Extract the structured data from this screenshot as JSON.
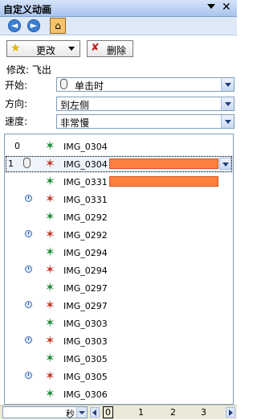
{
  "titlebar": {
    "title": "自定义动画",
    "close": "✕"
  },
  "nav": {
    "back": "◄",
    "forward": "►",
    "home": "⌂"
  },
  "toolbar": {
    "change_label": "更改",
    "remove_label": "删除"
  },
  "modify": {
    "label": "修改: 飞出"
  },
  "start": {
    "label": "开始:",
    "value": "单击时"
  },
  "direction": {
    "label": "方向:",
    "value": "到左侧"
  },
  "speed": {
    "label": "速度:",
    "value": "非常慢"
  },
  "colors": {
    "accent_bar": "#ff7f3f",
    "selection": "#316ac5"
  },
  "list": {
    "rows": [
      {
        "num": "0",
        "name": "IMG_0304"
      },
      {
        "num": "1",
        "name": "IMG_0304"
      },
      {
        "num": "",
        "name": "IMG_0331"
      },
      {
        "num": "",
        "name": "IMG_0331"
      },
      {
        "num": "",
        "name": "IMG_0292"
      },
      {
        "num": "",
        "name": "IMG_0292"
      },
      {
        "num": "",
        "name": "IMG_0294"
      },
      {
        "num": "",
        "name": "IMG_0294"
      },
      {
        "num": "",
        "name": "IMG_0297"
      },
      {
        "num": "",
        "name": "IMG_0297"
      },
      {
        "num": "",
        "name": "IMG_0303"
      },
      {
        "num": "",
        "name": "IMG_0303"
      },
      {
        "num": "",
        "name": "IMG_0305"
      },
      {
        "num": "",
        "name": "IMG_0305"
      },
      {
        "num": "",
        "name": "IMG_0306"
      }
    ]
  },
  "timeline": {
    "unit": "秒",
    "ticks": [
      "0",
      "1",
      "2",
      "3"
    ]
  }
}
